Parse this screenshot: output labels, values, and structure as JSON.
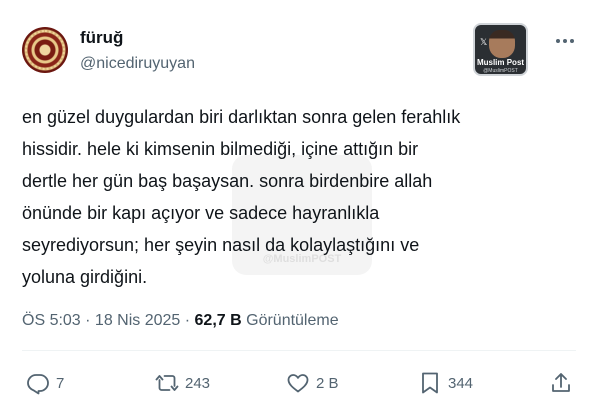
{
  "author": {
    "name": "füruğ",
    "handle": "@nicediruyuyan"
  },
  "badge": {
    "line1": "Muslim Post",
    "line2": "@MuslimPOST",
    "x_glyph": "𝕏"
  },
  "watermark": "@MuslimPOST",
  "tweet": {
    "text": "en güzel duygulardan biri darlıktan sonra gelen ferahlık\nhissidir. hele ki kimsenin bilmediği, içine attığın bir\ndertle her gün baş başaysan. sonra birdenbire allah\nönünde bir kapı açıyor ve sadece hayranlıkla\nseyrediyorsun; her şeyin nasıl da kolaylaştığını ve\nyoluna girdiğini."
  },
  "meta": {
    "time": "ÖS 5:03",
    "sep1": " · ",
    "date": "18 Nis 2025",
    "sep2": " · ",
    "views": "62,7 B",
    "views_label": " Görüntüleme"
  },
  "actions": {
    "reply_count": "7",
    "retweet_count": "243",
    "like_count": "2 B",
    "bookmark_count": "344"
  },
  "icons": {
    "reply": "reply-icon",
    "retweet": "retweet-icon",
    "like": "heart-icon",
    "bookmark": "bookmark-icon",
    "share": "share-icon",
    "more": "more-icon"
  },
  "colors": {
    "text": "#0f1419",
    "secondary": "#536471",
    "divider": "#eff3f4"
  }
}
